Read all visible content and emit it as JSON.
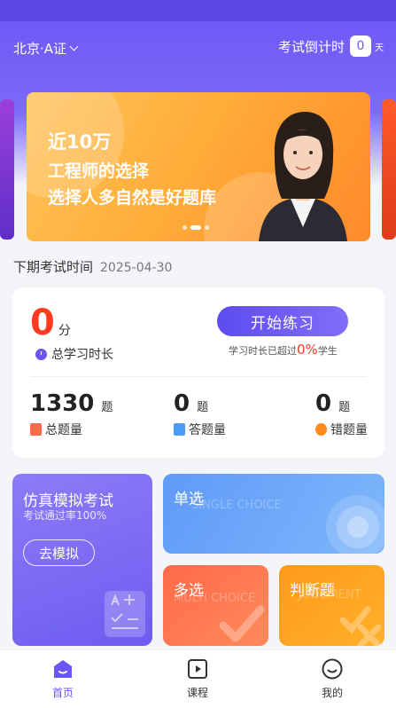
{
  "header": {
    "city": "北京·A证",
    "countdown_label": "考试倒计时",
    "countdown_value": "0",
    "countdown_unit": "天"
  },
  "banner": {
    "line1": "近10万",
    "line2": "工程师的选择",
    "line3": "选择人多自然是好题库"
  },
  "exam": {
    "label": "下期考试时间",
    "date": "2025-04-30"
  },
  "stats": {
    "score": "0",
    "score_unit": "分",
    "study_time_label": "总学习时长",
    "start_button": "开始练习",
    "exceed_prefix": "学习时长已超过",
    "exceed_pct": "0%",
    "exceed_suffix": "学生",
    "total_questions": "1330",
    "total_unit": "题",
    "total_label": "总题量",
    "answered": "0",
    "answered_unit": "题",
    "answered_label": "答题量",
    "wrong": "0",
    "wrong_unit": "题",
    "wrong_label": "错题量"
  },
  "tiles": {
    "mock_title": "仿真模拟考试",
    "mock_sub": "考试通过率100%",
    "mock_button": "去模拟",
    "single_title": "单选",
    "single_ghost": "SINGLE CHOICE",
    "multi_title": "多选",
    "multi_ghost": "MULTI CHOICE",
    "judge_title": "判断题",
    "judge_ghost": "JUDGMENT"
  },
  "tabbar": {
    "home": "首页",
    "course": "课程",
    "mine": "我的"
  },
  "colors": {
    "primary": "#6a56f5",
    "accent_red": "#ff3b1f"
  }
}
